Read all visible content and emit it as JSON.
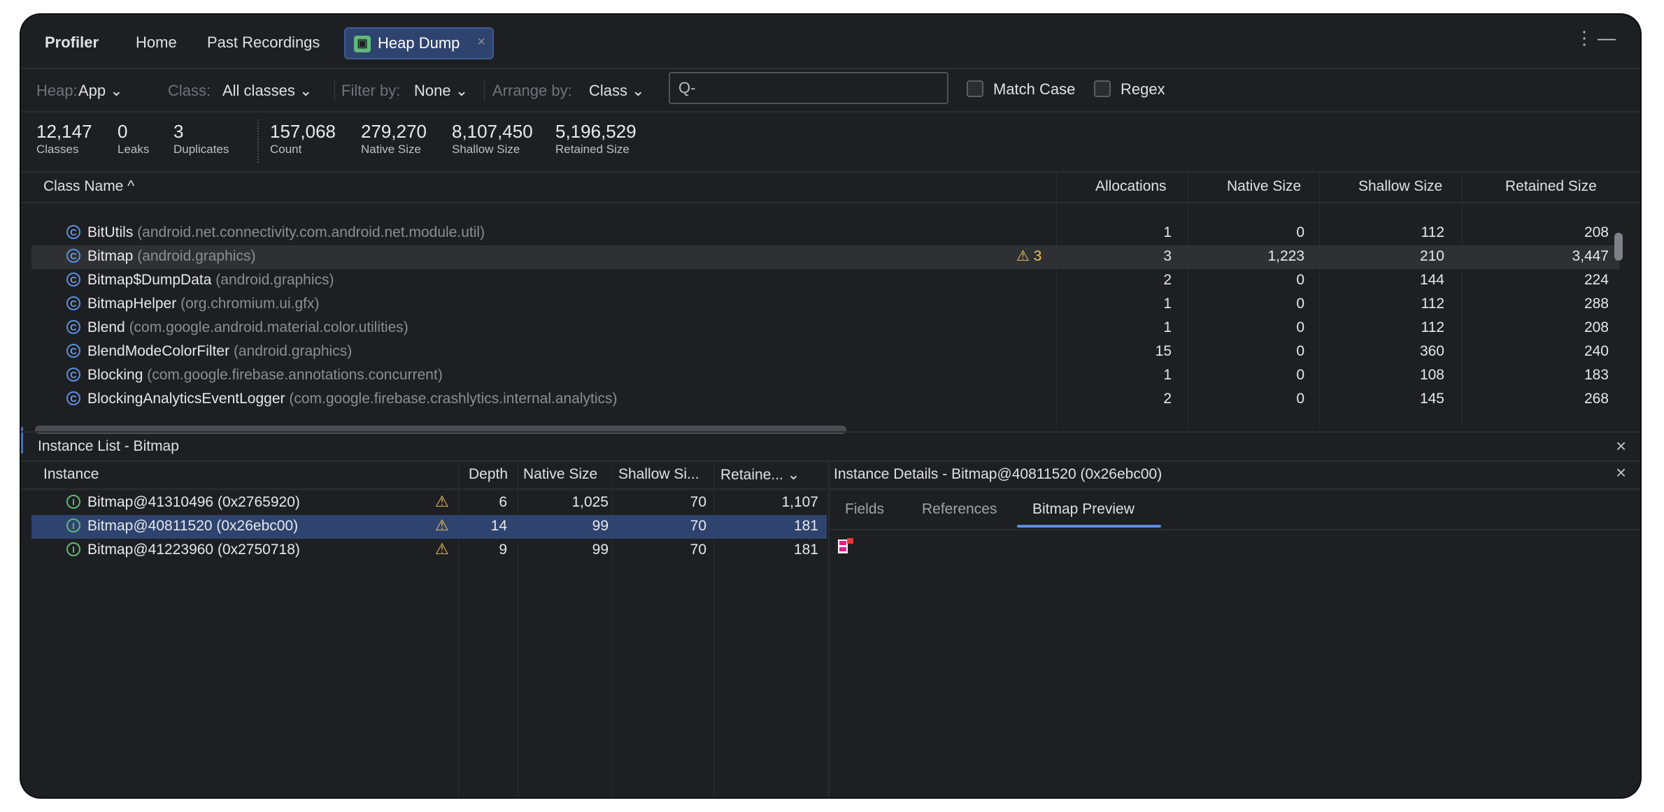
{
  "tabs": {
    "app": "Profiler",
    "home": "Home",
    "past": "Past Recordings",
    "active": "Heap Dump",
    "active_close": "×",
    "more_icon": "⋮",
    "minimize_icon": "—"
  },
  "filters": {
    "heap_label": "Heap:",
    "heap_value": "App",
    "class_label": "Class:",
    "class_value": "All classes",
    "filter_label": "Filter by:",
    "filter_value": "None",
    "arrange_label": "Arrange by:",
    "arrange_value": "Class",
    "search_placeholder": "",
    "search_icon": "Q-",
    "match_case": "Match Case",
    "regex": "Regex"
  },
  "summary": [
    {
      "value": "12,147",
      "label": "Classes"
    },
    {
      "value": "0",
      "label": "Leaks"
    },
    {
      "value": "3",
      "label": "Duplicates"
    },
    {
      "value": "157,068",
      "label": "Count"
    },
    {
      "value": "279,270",
      "label": "Native Size"
    },
    {
      "value": "8,107,450",
      "label": "Shallow Size"
    },
    {
      "value": "5,196,529",
      "label": "Retained Size"
    }
  ],
  "class_table": {
    "headers": {
      "name": "Class Name ^",
      "allocations": "Allocations",
      "native": "Native Size",
      "shallow": "Shallow Size",
      "retained": "Retained Size"
    },
    "rows": [
      {
        "name": "BitUtils",
        "pkg": "(android.net.connectivity.com.android.net.module.util)",
        "warn": "",
        "alloc": "1",
        "native": "0",
        "shallow": "112",
        "retained": "208"
      },
      {
        "name": "Bitmap",
        "pkg": "(android.graphics)",
        "warn": "⚠ 3",
        "alloc": "3",
        "native": "1,223",
        "shallow": "210",
        "retained": "3,447"
      },
      {
        "name": "Bitmap$DumpData",
        "pkg": "(android.graphics)",
        "warn": "",
        "alloc": "2",
        "native": "0",
        "shallow": "144",
        "retained": "224"
      },
      {
        "name": "BitmapHelper",
        "pkg": "(org.chromium.ui.gfx)",
        "warn": "",
        "alloc": "1",
        "native": "0",
        "shallow": "112",
        "retained": "288"
      },
      {
        "name": "Blend",
        "pkg": "(com.google.android.material.color.utilities)",
        "warn": "",
        "alloc": "1",
        "native": "0",
        "shallow": "112",
        "retained": "208"
      },
      {
        "name": "BlendModeColorFilter",
        "pkg": "(android.graphics)",
        "warn": "",
        "alloc": "15",
        "native": "0",
        "shallow": "360",
        "retained": "240"
      },
      {
        "name": "Blocking",
        "pkg": "(com.google.firebase.annotations.concurrent)",
        "warn": "",
        "alloc": "1",
        "native": "0",
        "shallow": "108",
        "retained": "183"
      },
      {
        "name": "BlockingAnalyticsEventLogger",
        "pkg": "(com.google.firebase.crashlytics.internal.analytics)",
        "warn": "",
        "alloc": "2",
        "native": "0",
        "shallow": "145",
        "retained": "268"
      }
    ]
  },
  "instance_list": {
    "title": "Instance List - Bitmap",
    "close_icon": "×",
    "headers": {
      "instance": "Instance",
      "depth": "Depth",
      "native": "Native Size",
      "shallow": "Shallow Si...",
      "retained": "Retaine... ⌄"
    },
    "rows": [
      {
        "name": "Bitmap@41310496 (0x2765920)",
        "depth": "6",
        "native": "1,025",
        "shallow": "70",
        "retained": "1,107"
      },
      {
        "name": "Bitmap@40811520 (0x26ebc00)",
        "depth": "14",
        "native": "99",
        "shallow": "70",
        "retained": "181"
      },
      {
        "name": "Bitmap@41223960 (0x2750718)",
        "depth": "9",
        "native": "99",
        "shallow": "70",
        "retained": "181"
      }
    ]
  },
  "details": {
    "title": "Instance Details - Bitmap@40811520 (0x26ebc00)",
    "close_icon": "×",
    "tabs": [
      "Fields",
      "References",
      "Bitmap Preview"
    ],
    "active_tab": 2
  },
  "icons": {
    "class_icon": "C",
    "instance_icon": "I",
    "warning_icon": "⚠"
  },
  "colors": {
    "background": "#1e1f22",
    "selection": "#2e436e",
    "accent": "#5b8ee0",
    "warning": "#f2c55c"
  }
}
